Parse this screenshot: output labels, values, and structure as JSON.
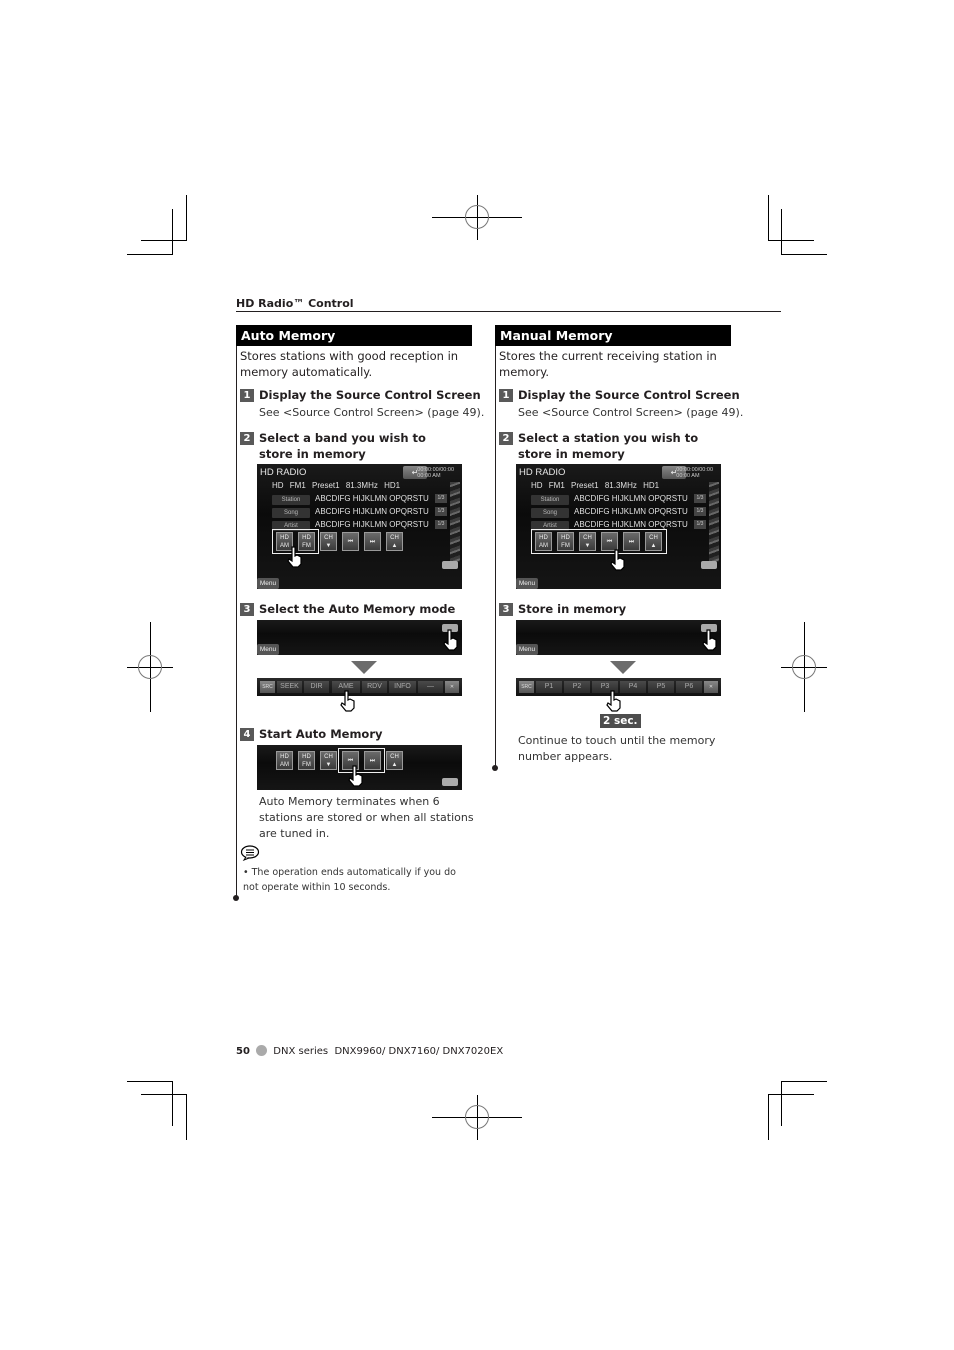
{
  "header": {
    "title": "HD Radio™ Control"
  },
  "auto_memory": {
    "heading": "Auto Memory",
    "intro": "Stores stations with good reception in memory automatically.",
    "steps": [
      {
        "num": "1",
        "title": "Display the Source Control Screen",
        "detail": "See <Source Control Screen> (page 49)."
      },
      {
        "num": "2",
        "title": "Select a band you wish to store in memory"
      },
      {
        "num": "3",
        "title": "Select the Auto Memory mode"
      },
      {
        "num": "4",
        "title": "Start Auto Memory",
        "detail": "Auto Memory terminates when 6 stations are stored or when all stations are tuned in."
      }
    ],
    "note": "The operation ends automatically if you do not operate within 10 seconds.",
    "function_bar": [
      "SEEK",
      "DIR",
      "AME",
      "RDV",
      "INFO",
      "—"
    ]
  },
  "manual_memory": {
    "heading": "Manual Memory",
    "intro": "Stores the current receiving station in memory.",
    "steps": [
      {
        "num": "1",
        "title": "Display the Source Control Screen",
        "detail": "See <Source Control Screen> (page 49)."
      },
      {
        "num": "2",
        "title": "Select a station you wish to store in memory"
      },
      {
        "num": "3",
        "title": "Store in memory",
        "detail": "Continue to touch until the memory number appears."
      }
    ],
    "hold_badge": "2 sec.",
    "preset_bar": [
      "P1",
      "P2",
      "P3",
      "P4",
      "P5",
      "P6"
    ]
  },
  "screen": {
    "title": "HD RADIO",
    "clock": [
      "00:00:00/00:00",
      "00:00 AM"
    ],
    "band": "HD FM1",
    "preset": "Preset1",
    "frequency": "81.3MHz",
    "channel": "HD1",
    "rows": [
      {
        "label": "Station",
        "value": "ABCDIFG HIJKLMN OPQRSTU",
        "tag": "1/3"
      },
      {
        "label": "Song",
        "value": "ABCDIFG HIJKLMN OPQRSTU",
        "tag": "1/3"
      },
      {
        "label": "Artist",
        "value": "ABCDIFG HIJKLMN OPQRSTU",
        "tag": "1/3"
      }
    ],
    "buttons": [
      {
        "line1": "HD",
        "line2": "AM"
      },
      {
        "line1": "HD",
        "line2": "FM"
      },
      {
        "line1": "CH",
        "line2": "▼"
      },
      {
        "line1": "⏮",
        "line2": ""
      },
      {
        "line1": "⏭",
        "line2": ""
      },
      {
        "line1": "CH",
        "line2": "▲"
      }
    ],
    "menu_label": "Menu",
    "back_label": "↵"
  },
  "footer": {
    "page_number": "50",
    "series": "DNX series",
    "models": "DNX9960/ DNX7160/ DNX7020EX"
  }
}
